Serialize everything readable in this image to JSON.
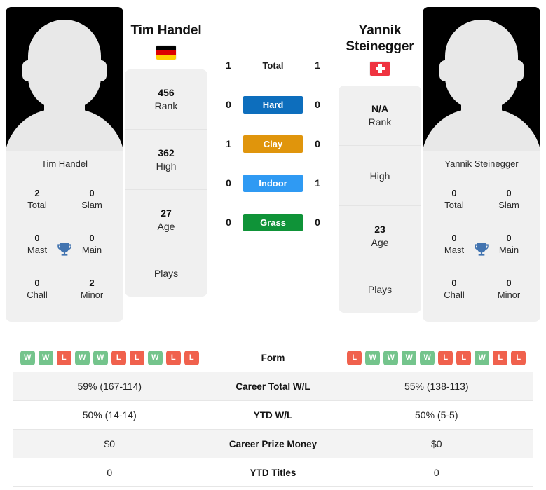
{
  "colors": {
    "hard": "#0d6ebd",
    "clay": "#e0950c",
    "indoor": "#2f9af3",
    "grass": "#0f9338",
    "win_badge": "#74c48c",
    "loss_badge": "#f0614d",
    "trophy": "#4274b0"
  },
  "left_player": {
    "name": "Tim Handel",
    "flag": "germany-flag",
    "card_name": "Tim Handel",
    "avatar": "player-avatar-placeholder",
    "titles": [
      {
        "value": "2",
        "label": "Total"
      },
      {
        "value": "0",
        "label": "Slam"
      },
      {
        "value": "0",
        "label": "Mast"
      },
      {
        "value": "0",
        "label": "Main"
      },
      {
        "value": "0",
        "label": "Chall"
      },
      {
        "value": "2",
        "label": "Minor"
      }
    ],
    "trophy_icon": "trophy-icon",
    "stats": [
      {
        "value": "456",
        "label": "Rank"
      },
      {
        "value": "362",
        "label": "High"
      },
      {
        "value": "27",
        "label": "Age"
      },
      {
        "value": "",
        "label": "Plays"
      }
    ]
  },
  "right_player": {
    "name": "Yannik Steinegger",
    "flag": "switzerland-flag",
    "card_name": "Yannik Steinegger",
    "avatar": "player-avatar-placeholder",
    "titles": [
      {
        "value": "0",
        "label": "Total"
      },
      {
        "value": "0",
        "label": "Slam"
      },
      {
        "value": "0",
        "label": "Mast"
      },
      {
        "value": "0",
        "label": "Main"
      },
      {
        "value": "0",
        "label": "Chall"
      },
      {
        "value": "0",
        "label": "Minor"
      }
    ],
    "trophy_icon": "trophy-icon",
    "stats": [
      {
        "value": "N/A",
        "label": "Rank"
      },
      {
        "value": "",
        "label": "High"
      },
      {
        "value": "23",
        "label": "Age"
      },
      {
        "value": "",
        "label": "Plays"
      }
    ]
  },
  "head_to_head": [
    {
      "label": "Total",
      "left": "1",
      "right": "1",
      "style": "plain",
      "color": ""
    },
    {
      "label": "Hard",
      "left": "0",
      "right": "0",
      "style": "pill",
      "color": "#0d6ebd"
    },
    {
      "label": "Clay",
      "left": "1",
      "right": "0",
      "style": "pill",
      "color": "#e0950c"
    },
    {
      "label": "Indoor",
      "left": "0",
      "right": "1",
      "style": "pill",
      "color": "#2f9af3"
    },
    {
      "label": "Grass",
      "left": "0",
      "right": "0",
      "style": "pill",
      "color": "#0f9338"
    }
  ],
  "comparison": {
    "form": {
      "label": "Form",
      "left": [
        "W",
        "W",
        "L",
        "W",
        "W",
        "L",
        "L",
        "W",
        "L",
        "L"
      ],
      "right": [
        "L",
        "W",
        "W",
        "W",
        "W",
        "L",
        "L",
        "W",
        "L",
        "L"
      ]
    },
    "rows": [
      {
        "label": "Career Total W/L",
        "left": "59% (167-114)",
        "right": "55% (138-113)"
      },
      {
        "label": "YTD W/L",
        "left": "50% (14-14)",
        "right": "50% (5-5)"
      },
      {
        "label": "Career Prize Money",
        "left": "$0",
        "right": "$0"
      },
      {
        "label": "YTD Titles",
        "left": "0",
        "right": "0"
      }
    ]
  }
}
